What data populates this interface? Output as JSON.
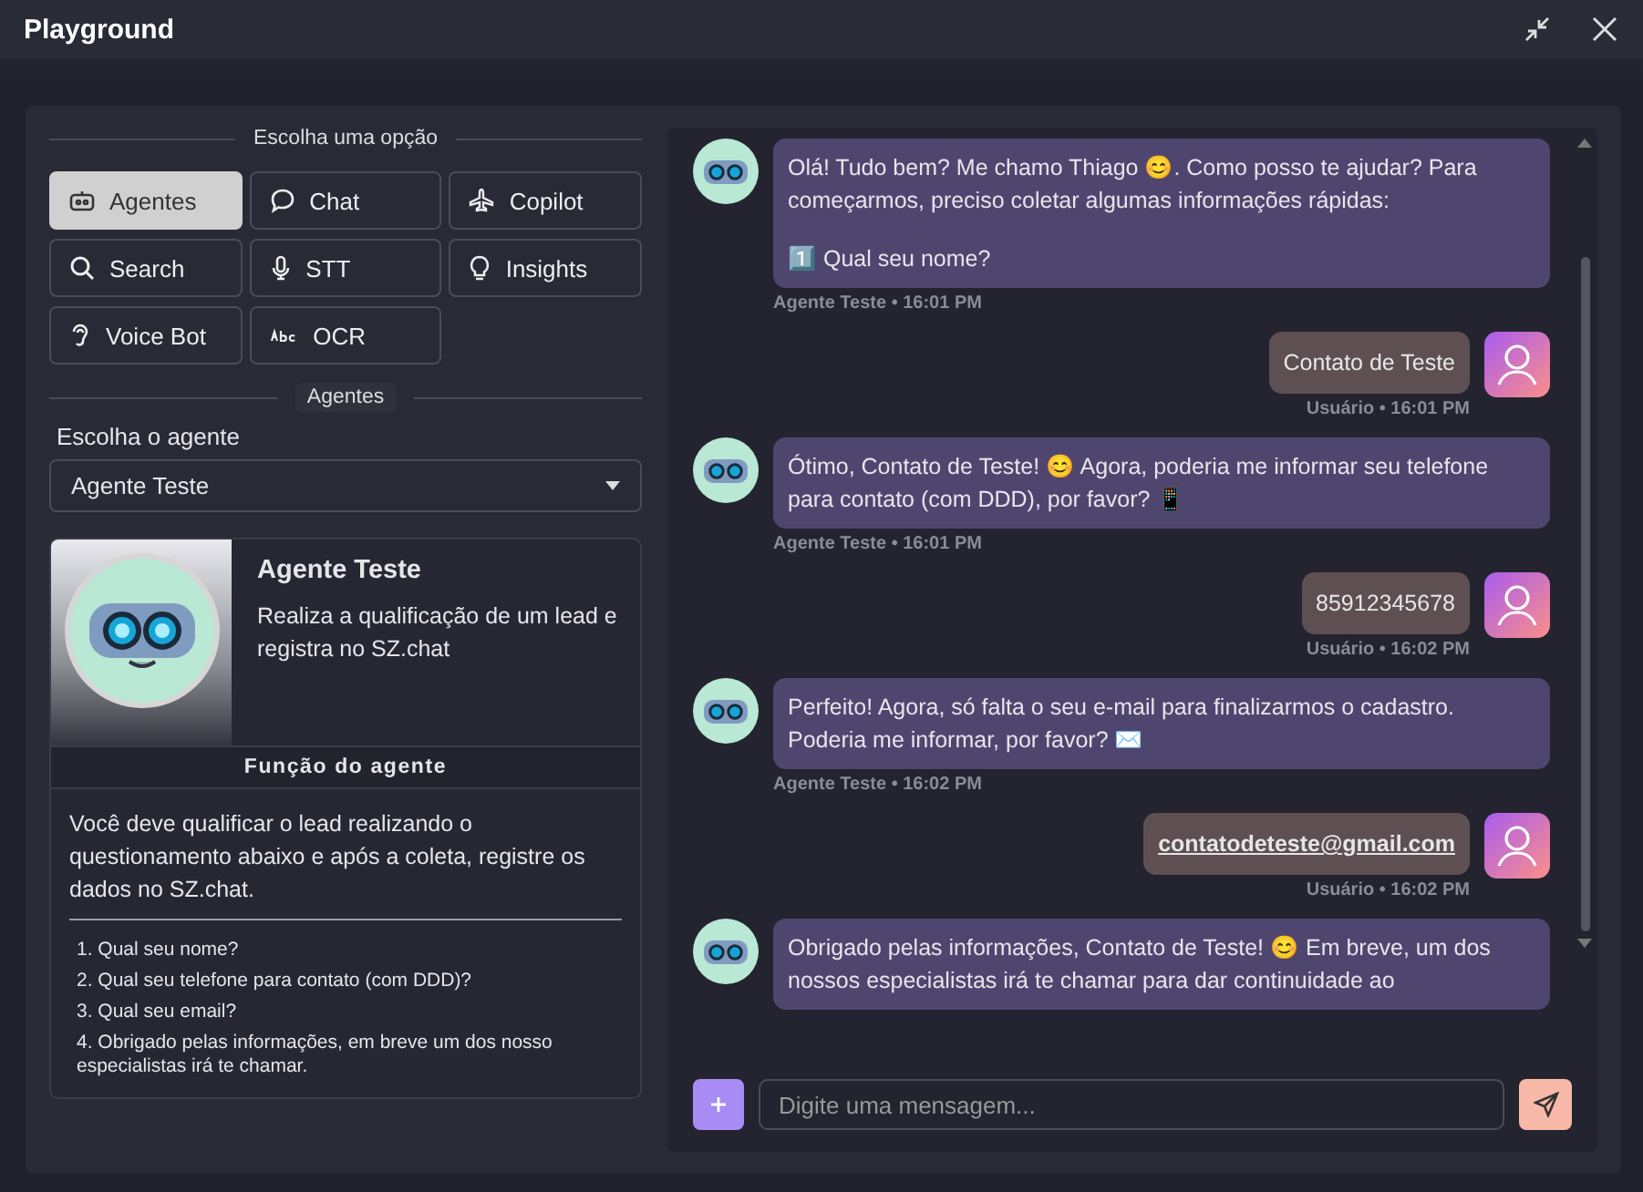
{
  "window": {
    "title": "Playground"
  },
  "options": {
    "heading": "Escolha uma opção",
    "items": [
      {
        "label": "Agentes",
        "selected": true
      },
      {
        "label": "Chat",
        "selected": false
      },
      {
        "label": "Copilot",
        "selected": false
      },
      {
        "label": "Search",
        "selected": false
      },
      {
        "label": "STT",
        "selected": false
      },
      {
        "label": "Insights",
        "selected": false
      },
      {
        "label": "Voice Bot",
        "selected": false
      },
      {
        "label": "OCR",
        "selected": false
      }
    ]
  },
  "agents": {
    "heading": "Agentes",
    "select_label": "Escolha o agente",
    "select_value": "Agente Teste",
    "card": {
      "name": "Agente Teste",
      "description": "Realiza a qualificação de um lead e registra no SZ.chat",
      "function_heading": "Função do agente",
      "function_text": "Você deve qualificar o lead realizando o questionamento abaixo e após a coleta, registre os dados no SZ.chat.",
      "steps": [
        "1. Qual seu nome?",
        "2. Qual seu telefone para contato (com DDD)?",
        "3. Qual seu email?",
        "4. Obrigado pelas informações, em breve um dos nosso especialistas irá te chamar."
      ]
    }
  },
  "chat": {
    "messages": [
      {
        "kind": "bot",
        "lines": [
          "Olá! Tudo bem? Me chamo Thiago 😊. Como posso te ajudar? Para começarmos, preciso coletar algumas informações rápidas:",
          "1️⃣ Qual seu nome?"
        ],
        "meta": "Agente Teste • 16:01 PM"
      },
      {
        "kind": "user",
        "lines": [
          "Contato de Teste"
        ],
        "meta": "Usuário • 16:01 PM"
      },
      {
        "kind": "bot",
        "lines": [
          "Ótimo, Contato de Teste! 😊 Agora, poderia me informar seu telefone para contato (com DDD), por favor? 📱"
        ],
        "meta": "Agente Teste • 16:01 PM"
      },
      {
        "kind": "user",
        "lines": [
          "85912345678"
        ],
        "meta": "Usuário • 16:02 PM"
      },
      {
        "kind": "bot",
        "lines": [
          "Perfeito! Agora, só falta o seu e-mail para finalizarmos o cadastro. Poderia me informar, por favor? ✉️"
        ],
        "meta": "Agente Teste • 16:02 PM"
      },
      {
        "kind": "user",
        "link": true,
        "lines": [
          "contatodeteste@gmail.com"
        ],
        "meta": "Usuário • 16:02 PM"
      },
      {
        "kind": "bot",
        "lines": [
          "Obrigado pelas informações, Contato de Teste! 😊 Em breve, um dos nossos especialistas irá te chamar para dar continuidade ao"
        ]
      }
    ],
    "input": {
      "placeholder": "Digite uma mensagem..."
    }
  }
}
